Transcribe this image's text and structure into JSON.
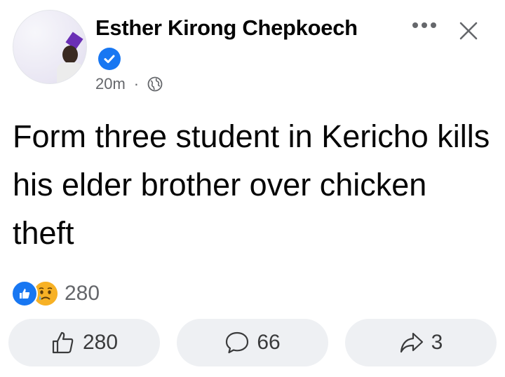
{
  "post": {
    "author_name": "Esther Kirong Chepkoech",
    "time": "20m",
    "separator": "·",
    "privacy_icon": "globe-icon",
    "verified_icon": "verified-badge-icon",
    "text": "Form three student in Kericho kills his elder brother over chicken theft"
  },
  "reactions": {
    "types": [
      "like",
      "sad"
    ],
    "count": "280"
  },
  "actions": {
    "like_count": "280",
    "comment_count": "66",
    "share_count": "3"
  },
  "colors": {
    "accent": "#1877f2",
    "button_bg": "#eef0f3",
    "secondary_text": "#65676b"
  }
}
